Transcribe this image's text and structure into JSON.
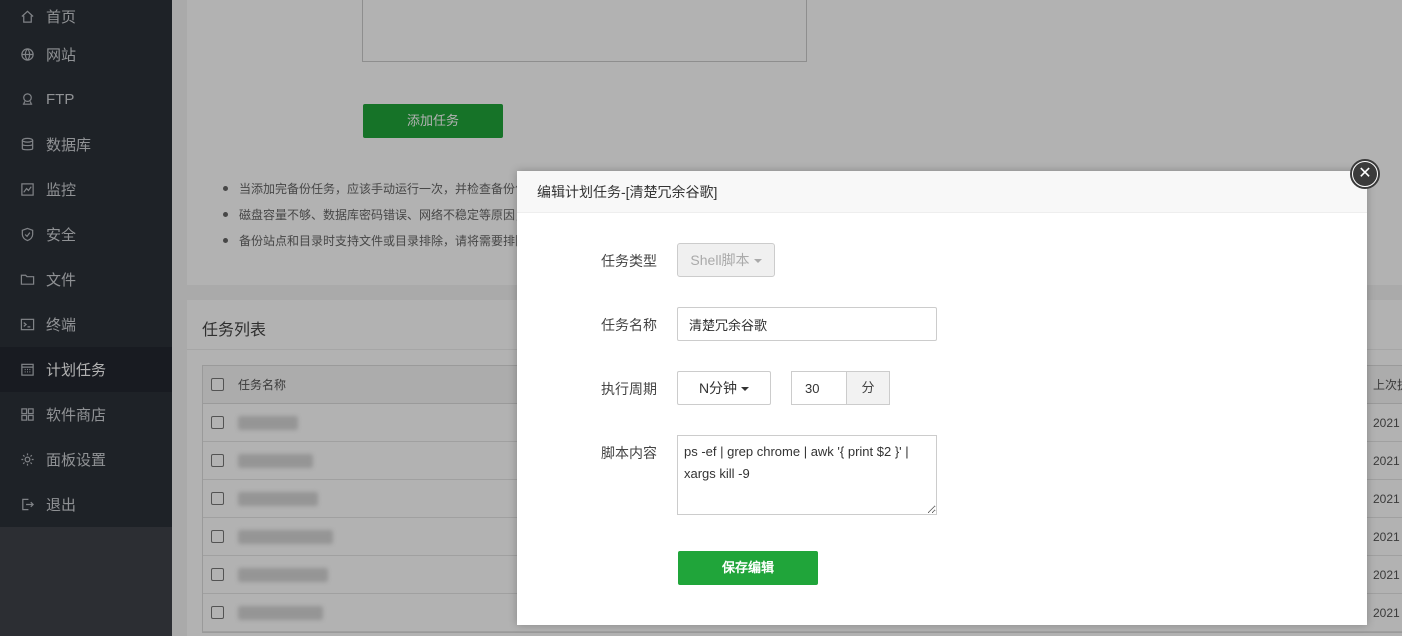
{
  "sidebar": {
    "items": [
      {
        "label": "首页",
        "icon": "home-icon"
      },
      {
        "label": "网站",
        "icon": "globe-icon"
      },
      {
        "label": "FTP",
        "icon": "ftp-icon"
      },
      {
        "label": "数据库",
        "icon": "database-icon"
      },
      {
        "label": "监控",
        "icon": "monitor-icon"
      },
      {
        "label": "安全",
        "icon": "shield-icon"
      },
      {
        "label": "文件",
        "icon": "folder-icon"
      },
      {
        "label": "终端",
        "icon": "terminal-icon"
      },
      {
        "label": "计划任务",
        "icon": "calendar-icon",
        "active": true
      },
      {
        "label": "软件商店",
        "icon": "grid-icon"
      },
      {
        "label": "面板设置",
        "icon": "gear-icon"
      },
      {
        "label": "退出",
        "icon": "logout-icon"
      }
    ]
  },
  "top": {
    "add_button": "添加任务",
    "tips": [
      "当添加完备份任务，应该手动运行一次，并检查备份包是",
      "磁盘容量不够、数据库密码错误、网络不稳定等原因，可",
      "备份站点和目录时支持文件或目录排除，请将需要排除项"
    ]
  },
  "task_list": {
    "title": "任务列表",
    "columns": {
      "name": "任务名称",
      "last_run": "上次执"
    },
    "rows": [
      {
        "date": "2021"
      },
      {
        "date": "2021"
      },
      {
        "date": "2021"
      },
      {
        "date": "2021"
      },
      {
        "date": "2021"
      },
      {
        "date": "2021"
      }
    ]
  },
  "modal": {
    "title": "编辑计划任务-[清楚冗余谷歌]",
    "type_label": "任务类型",
    "type_value": "Shell脚本",
    "name_label": "任务名称",
    "name_value": "清楚冗余谷歌",
    "cycle_label": "执行周期",
    "cycle_value": "N分钟",
    "minutes_value": "30",
    "minutes_unit": "分",
    "script_label": "脚本内容",
    "script_value": "ps -ef | grep chrome | awk '{ print $2 }' | xargs kill -9",
    "save_button": "保存编辑"
  },
  "colors": {
    "accent": "#20a53a",
    "sidebar": "#2c3138"
  }
}
